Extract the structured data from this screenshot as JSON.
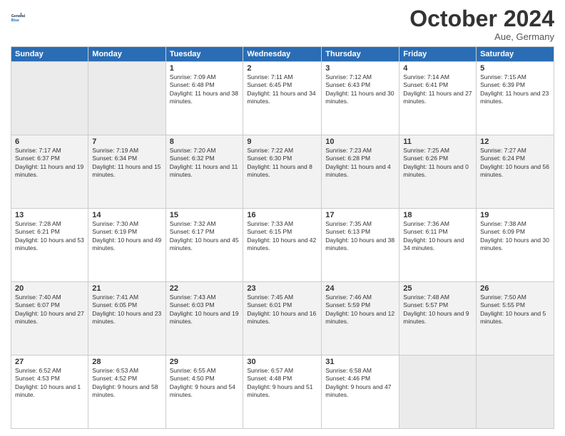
{
  "header": {
    "logo_line1": "General",
    "logo_line2": "Blue",
    "month": "October 2024",
    "location": "Aue, Germany"
  },
  "days_of_week": [
    "Sunday",
    "Monday",
    "Tuesday",
    "Wednesday",
    "Thursday",
    "Friday",
    "Saturday"
  ],
  "weeks": [
    [
      {
        "day": "",
        "sunrise": "",
        "sunset": "",
        "daylight": ""
      },
      {
        "day": "",
        "sunrise": "",
        "sunset": "",
        "daylight": ""
      },
      {
        "day": "1",
        "sunrise": "Sunrise: 7:09 AM",
        "sunset": "Sunset: 6:48 PM",
        "daylight": "Daylight: 11 hours and 38 minutes."
      },
      {
        "day": "2",
        "sunrise": "Sunrise: 7:11 AM",
        "sunset": "Sunset: 6:45 PM",
        "daylight": "Daylight: 11 hours and 34 minutes."
      },
      {
        "day": "3",
        "sunrise": "Sunrise: 7:12 AM",
        "sunset": "Sunset: 6:43 PM",
        "daylight": "Daylight: 11 hours and 30 minutes."
      },
      {
        "day": "4",
        "sunrise": "Sunrise: 7:14 AM",
        "sunset": "Sunset: 6:41 PM",
        "daylight": "Daylight: 11 hours and 27 minutes."
      },
      {
        "day": "5",
        "sunrise": "Sunrise: 7:15 AM",
        "sunset": "Sunset: 6:39 PM",
        "daylight": "Daylight: 11 hours and 23 minutes."
      }
    ],
    [
      {
        "day": "6",
        "sunrise": "Sunrise: 7:17 AM",
        "sunset": "Sunset: 6:37 PM",
        "daylight": "Daylight: 11 hours and 19 minutes."
      },
      {
        "day": "7",
        "sunrise": "Sunrise: 7:19 AM",
        "sunset": "Sunset: 6:34 PM",
        "daylight": "Daylight: 11 hours and 15 minutes."
      },
      {
        "day": "8",
        "sunrise": "Sunrise: 7:20 AM",
        "sunset": "Sunset: 6:32 PM",
        "daylight": "Daylight: 11 hours and 11 minutes."
      },
      {
        "day": "9",
        "sunrise": "Sunrise: 7:22 AM",
        "sunset": "Sunset: 6:30 PM",
        "daylight": "Daylight: 11 hours and 8 minutes."
      },
      {
        "day": "10",
        "sunrise": "Sunrise: 7:23 AM",
        "sunset": "Sunset: 6:28 PM",
        "daylight": "Daylight: 11 hours and 4 minutes."
      },
      {
        "day": "11",
        "sunrise": "Sunrise: 7:25 AM",
        "sunset": "Sunset: 6:26 PM",
        "daylight": "Daylight: 11 hours and 0 minutes."
      },
      {
        "day": "12",
        "sunrise": "Sunrise: 7:27 AM",
        "sunset": "Sunset: 6:24 PM",
        "daylight": "Daylight: 10 hours and 56 minutes."
      }
    ],
    [
      {
        "day": "13",
        "sunrise": "Sunrise: 7:28 AM",
        "sunset": "Sunset: 6:21 PM",
        "daylight": "Daylight: 10 hours and 53 minutes."
      },
      {
        "day": "14",
        "sunrise": "Sunrise: 7:30 AM",
        "sunset": "Sunset: 6:19 PM",
        "daylight": "Daylight: 10 hours and 49 minutes."
      },
      {
        "day": "15",
        "sunrise": "Sunrise: 7:32 AM",
        "sunset": "Sunset: 6:17 PM",
        "daylight": "Daylight: 10 hours and 45 minutes."
      },
      {
        "day": "16",
        "sunrise": "Sunrise: 7:33 AM",
        "sunset": "Sunset: 6:15 PM",
        "daylight": "Daylight: 10 hours and 42 minutes."
      },
      {
        "day": "17",
        "sunrise": "Sunrise: 7:35 AM",
        "sunset": "Sunset: 6:13 PM",
        "daylight": "Daylight: 10 hours and 38 minutes."
      },
      {
        "day": "18",
        "sunrise": "Sunrise: 7:36 AM",
        "sunset": "Sunset: 6:11 PM",
        "daylight": "Daylight: 10 hours and 34 minutes."
      },
      {
        "day": "19",
        "sunrise": "Sunrise: 7:38 AM",
        "sunset": "Sunset: 6:09 PM",
        "daylight": "Daylight: 10 hours and 30 minutes."
      }
    ],
    [
      {
        "day": "20",
        "sunrise": "Sunrise: 7:40 AM",
        "sunset": "Sunset: 6:07 PM",
        "daylight": "Daylight: 10 hours and 27 minutes."
      },
      {
        "day": "21",
        "sunrise": "Sunrise: 7:41 AM",
        "sunset": "Sunset: 6:05 PM",
        "daylight": "Daylight: 10 hours and 23 minutes."
      },
      {
        "day": "22",
        "sunrise": "Sunrise: 7:43 AM",
        "sunset": "Sunset: 6:03 PM",
        "daylight": "Daylight: 10 hours and 19 minutes."
      },
      {
        "day": "23",
        "sunrise": "Sunrise: 7:45 AM",
        "sunset": "Sunset: 6:01 PM",
        "daylight": "Daylight: 10 hours and 16 minutes."
      },
      {
        "day": "24",
        "sunrise": "Sunrise: 7:46 AM",
        "sunset": "Sunset: 5:59 PM",
        "daylight": "Daylight: 10 hours and 12 minutes."
      },
      {
        "day": "25",
        "sunrise": "Sunrise: 7:48 AM",
        "sunset": "Sunset: 5:57 PM",
        "daylight": "Daylight: 10 hours and 9 minutes."
      },
      {
        "day": "26",
        "sunrise": "Sunrise: 7:50 AM",
        "sunset": "Sunset: 5:55 PM",
        "daylight": "Daylight: 10 hours and 5 minutes."
      }
    ],
    [
      {
        "day": "27",
        "sunrise": "Sunrise: 6:52 AM",
        "sunset": "Sunset: 4:53 PM",
        "daylight": "Daylight: 10 hours and 1 minute."
      },
      {
        "day": "28",
        "sunrise": "Sunrise: 6:53 AM",
        "sunset": "Sunset: 4:52 PM",
        "daylight": "Daylight: 9 hours and 58 minutes."
      },
      {
        "day": "29",
        "sunrise": "Sunrise: 6:55 AM",
        "sunset": "Sunset: 4:50 PM",
        "daylight": "Daylight: 9 hours and 54 minutes."
      },
      {
        "day": "30",
        "sunrise": "Sunrise: 6:57 AM",
        "sunset": "Sunset: 4:48 PM",
        "daylight": "Daylight: 9 hours and 51 minutes."
      },
      {
        "day": "31",
        "sunrise": "Sunrise: 6:58 AM",
        "sunset": "Sunset: 4:46 PM",
        "daylight": "Daylight: 9 hours and 47 minutes."
      },
      {
        "day": "",
        "sunrise": "",
        "sunset": "",
        "daylight": ""
      },
      {
        "day": "",
        "sunrise": "",
        "sunset": "",
        "daylight": ""
      }
    ]
  ]
}
